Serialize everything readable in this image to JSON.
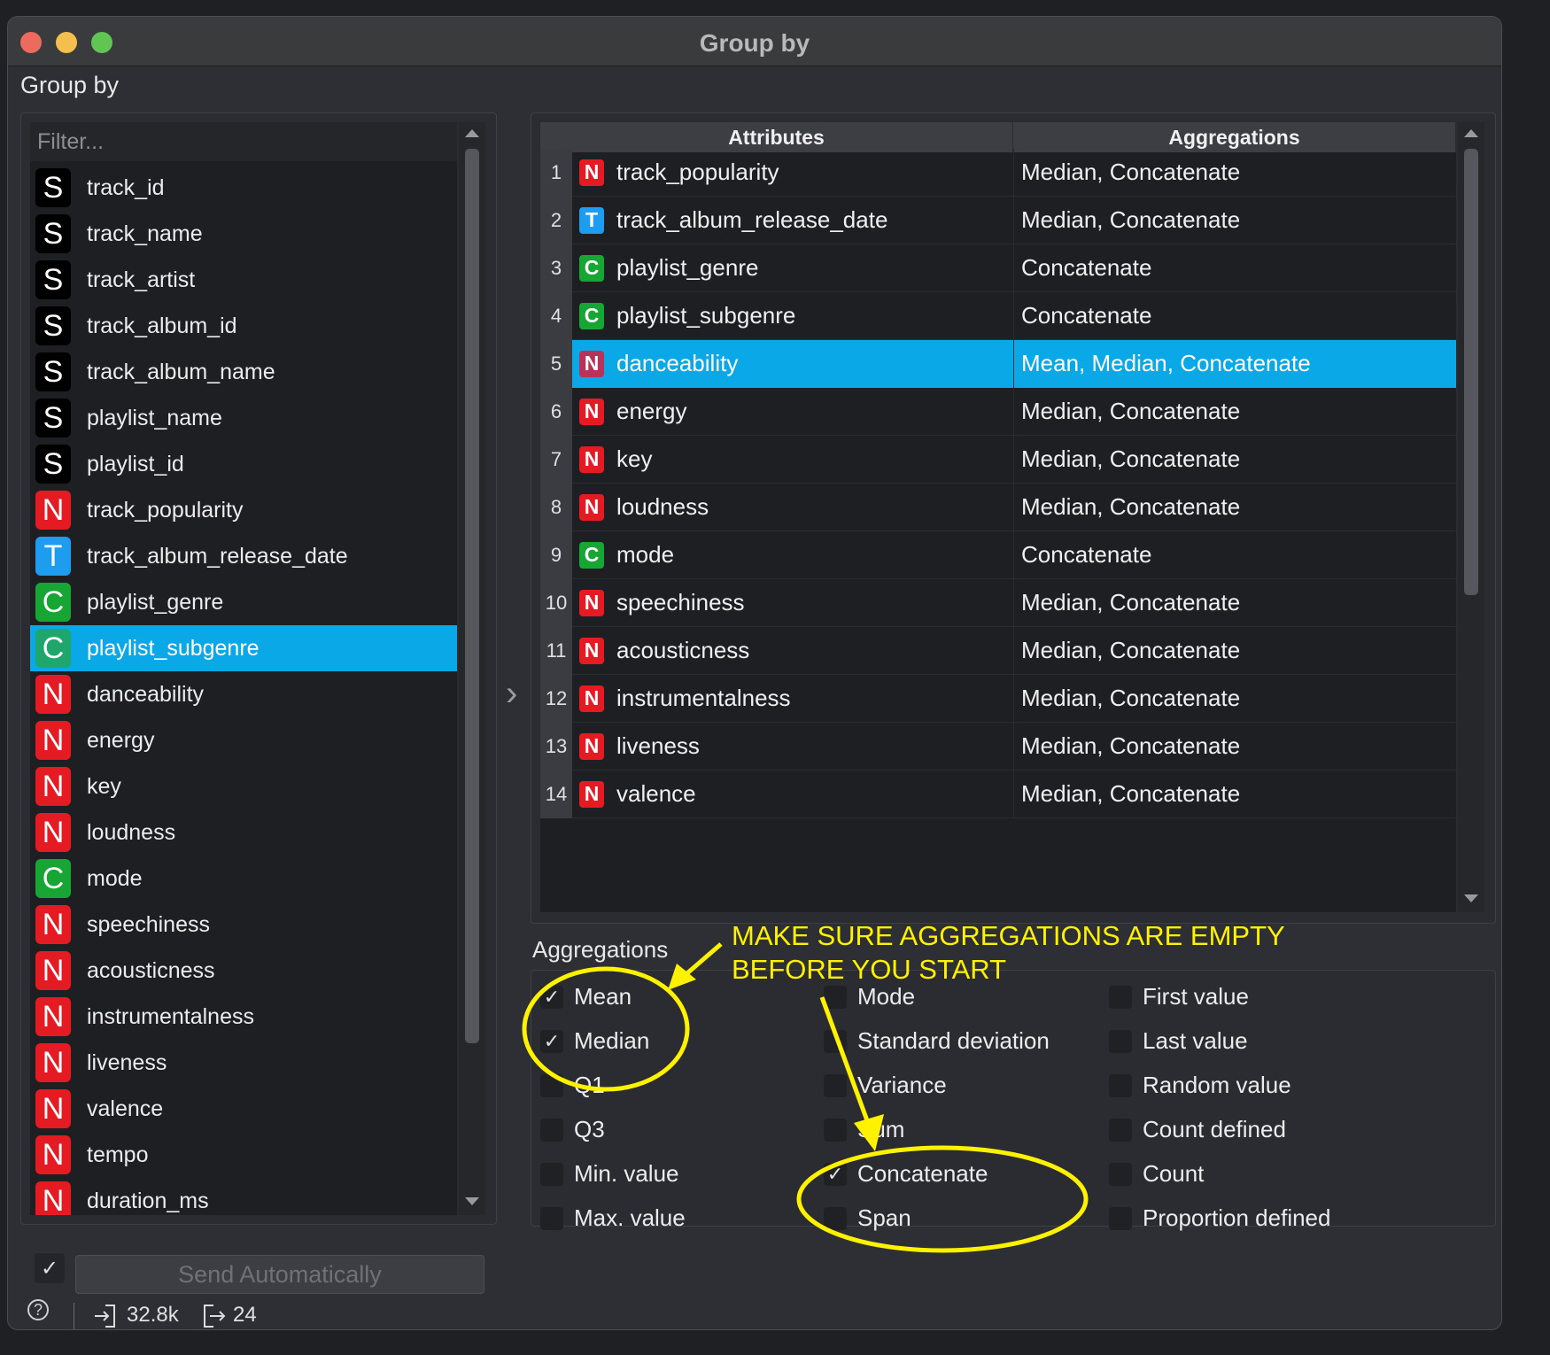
{
  "window": {
    "title": "Group by"
  },
  "group_by": {
    "title": "Group by",
    "filter_placeholder": "Filter...",
    "items": [
      {
        "type": "S",
        "name": "track_id",
        "selected": false
      },
      {
        "type": "S",
        "name": "track_name",
        "selected": false
      },
      {
        "type": "S",
        "name": "track_artist",
        "selected": false
      },
      {
        "type": "S",
        "name": "track_album_id",
        "selected": false
      },
      {
        "type": "S",
        "name": "track_album_name",
        "selected": false
      },
      {
        "type": "S",
        "name": "playlist_name",
        "selected": false
      },
      {
        "type": "S",
        "name": "playlist_id",
        "selected": false
      },
      {
        "type": "N",
        "name": "track_popularity",
        "selected": false
      },
      {
        "type": "T",
        "name": "track_album_release_date",
        "selected": false
      },
      {
        "type": "C",
        "name": "playlist_genre",
        "selected": false
      },
      {
        "type": "C",
        "name": "playlist_subgenre",
        "selected": true
      },
      {
        "type": "N",
        "name": "danceability",
        "selected": false
      },
      {
        "type": "N",
        "name": "energy",
        "selected": false
      },
      {
        "type": "N",
        "name": "key",
        "selected": false
      },
      {
        "type": "N",
        "name": "loudness",
        "selected": false
      },
      {
        "type": "C",
        "name": "mode",
        "selected": false
      },
      {
        "type": "N",
        "name": "speechiness",
        "selected": false
      },
      {
        "type": "N",
        "name": "acousticness",
        "selected": false
      },
      {
        "type": "N",
        "name": "instrumentalness",
        "selected": false
      },
      {
        "type": "N",
        "name": "liveness",
        "selected": false
      },
      {
        "type": "N",
        "name": "valence",
        "selected": false
      },
      {
        "type": "N",
        "name": "tempo",
        "selected": false
      },
      {
        "type": "N",
        "name": "duration_ms",
        "selected": false
      }
    ],
    "send_automatically_label": "Send Automatically",
    "send_automatically_checked": true,
    "send_check_mark": "✓"
  },
  "transfer_arrow": "›",
  "table": {
    "headers": [
      "Attributes",
      "Aggregations"
    ],
    "rows": [
      {
        "num": "1",
        "type": "N",
        "attribute": "track_popularity",
        "aggregations": "Median, Concatenate",
        "selected": false
      },
      {
        "num": "2",
        "type": "T",
        "attribute": "track_album_release_date",
        "aggregations": "Median, Concatenate",
        "selected": false
      },
      {
        "num": "3",
        "type": "C",
        "attribute": "playlist_genre",
        "aggregations": "Concatenate",
        "selected": false
      },
      {
        "num": "4",
        "type": "C",
        "attribute": "playlist_subgenre",
        "aggregations": "Concatenate",
        "selected": false
      },
      {
        "num": "5",
        "type": "N",
        "attribute": "danceability",
        "aggregations": "Mean, Median, Concatenate",
        "selected": true
      },
      {
        "num": "6",
        "type": "N",
        "attribute": "energy",
        "aggregations": "Median, Concatenate",
        "selected": false
      },
      {
        "num": "7",
        "type": "N",
        "attribute": "key",
        "aggregations": "Median, Concatenate",
        "selected": false
      },
      {
        "num": "8",
        "type": "N",
        "attribute": "loudness",
        "aggregations": "Median, Concatenate",
        "selected": false
      },
      {
        "num": "9",
        "type": "C",
        "attribute": "mode",
        "aggregations": "Concatenate",
        "selected": false
      },
      {
        "num": "10",
        "type": "N",
        "attribute": "speechiness",
        "aggregations": "Median, Concatenate",
        "selected": false
      },
      {
        "num": "11",
        "type": "N",
        "attribute": "acousticness",
        "aggregations": "Median, Concatenate",
        "selected": false
      },
      {
        "num": "12",
        "type": "N",
        "attribute": "instrumentalness",
        "aggregations": "Median, Concatenate",
        "selected": false
      },
      {
        "num": "13",
        "type": "N",
        "attribute": "liveness",
        "aggregations": "Median, Concatenate",
        "selected": false
      },
      {
        "num": "14",
        "type": "N",
        "attribute": "valence",
        "aggregations": "Median, Concatenate",
        "selected": false
      }
    ]
  },
  "aggregations": {
    "title": "Aggregations",
    "columns": [
      [
        {
          "label": "Mean",
          "checked": true
        },
        {
          "label": "Median",
          "checked": true
        },
        {
          "label": "Q1",
          "checked": false
        },
        {
          "label": "Q3",
          "checked": false
        },
        {
          "label": "Min. value",
          "checked": false
        },
        {
          "label": "Max. value",
          "checked": false
        }
      ],
      [
        {
          "label": "Mode",
          "checked": false
        },
        {
          "label": "Standard deviation",
          "checked": false
        },
        {
          "label": "Variance",
          "checked": false
        },
        {
          "label": "Sum",
          "checked": false
        },
        {
          "label": "Concatenate",
          "checked": true
        },
        {
          "label": "Span",
          "checked": false
        }
      ],
      [
        {
          "label": "First value",
          "checked": false
        },
        {
          "label": "Last value",
          "checked": false
        },
        {
          "label": "Random value",
          "checked": false
        },
        {
          "label": "Count defined",
          "checked": false
        },
        {
          "label": "Count",
          "checked": false
        },
        {
          "label": "Proportion defined",
          "checked": false
        }
      ]
    ],
    "check_mark": "✓"
  },
  "annotation": {
    "line1": "MAKE SURE AGGREGATIONS ARE EMPTY",
    "line2": "BEFORE YOU START",
    "color": "#fff200"
  },
  "status": {
    "help_icon": "?",
    "input_count": "32.8k",
    "output_count": "24"
  },
  "colors": {
    "selection": "#0aa8e6",
    "type_S": "#000000",
    "type_N": "#e51b24",
    "type_T": "#1e9cf0",
    "type_C": "#17a534"
  }
}
